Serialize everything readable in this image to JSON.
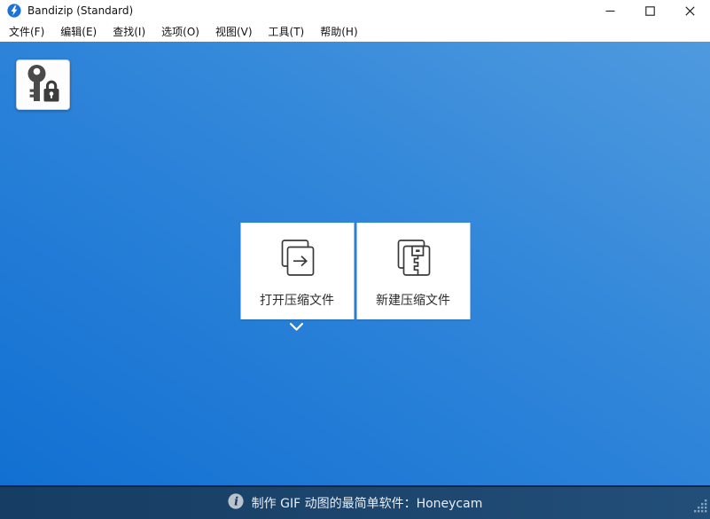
{
  "window": {
    "title": "Bandizip (Standard)",
    "logo_icon": "bandizip-bolt-icon",
    "controls": {
      "minimize_icon": "minimize-icon",
      "maximize_icon": "maximize-icon",
      "close_icon": "close-icon"
    }
  },
  "menu": {
    "items": [
      {
        "label": "文件(F)"
      },
      {
        "label": "编辑(E)"
      },
      {
        "label": "查找(I)"
      },
      {
        "label": "选项(O)"
      },
      {
        "label": "视图(V)"
      },
      {
        "label": "工具(T)"
      },
      {
        "label": "帮助(H)"
      }
    ]
  },
  "toolbar": {
    "password_button_icon": "key-lock-icon"
  },
  "main": {
    "open_archive": {
      "label": "打开压缩文件",
      "icon": "open-archive-icon"
    },
    "new_archive": {
      "label": "新建压缩文件",
      "icon": "new-archive-icon"
    },
    "recent_chevron_icon": "chevron-down-icon"
  },
  "statusbar": {
    "info_icon": "info-icon",
    "message": "制作 GIF 动图的最简单软件：Honeycam",
    "resize_grip_icon": "resize-grip"
  },
  "colors": {
    "body_gradient_light": "#4f9ade",
    "body_gradient_dark": "#1270d2",
    "statusbar_left": "#163d63",
    "statusbar_right": "#224f79",
    "titlebar_bg": "#ffffff",
    "button_bg": "#ffffff",
    "icon_stroke": "#3a3a3a",
    "logo_blue": "#1b72d8"
  }
}
